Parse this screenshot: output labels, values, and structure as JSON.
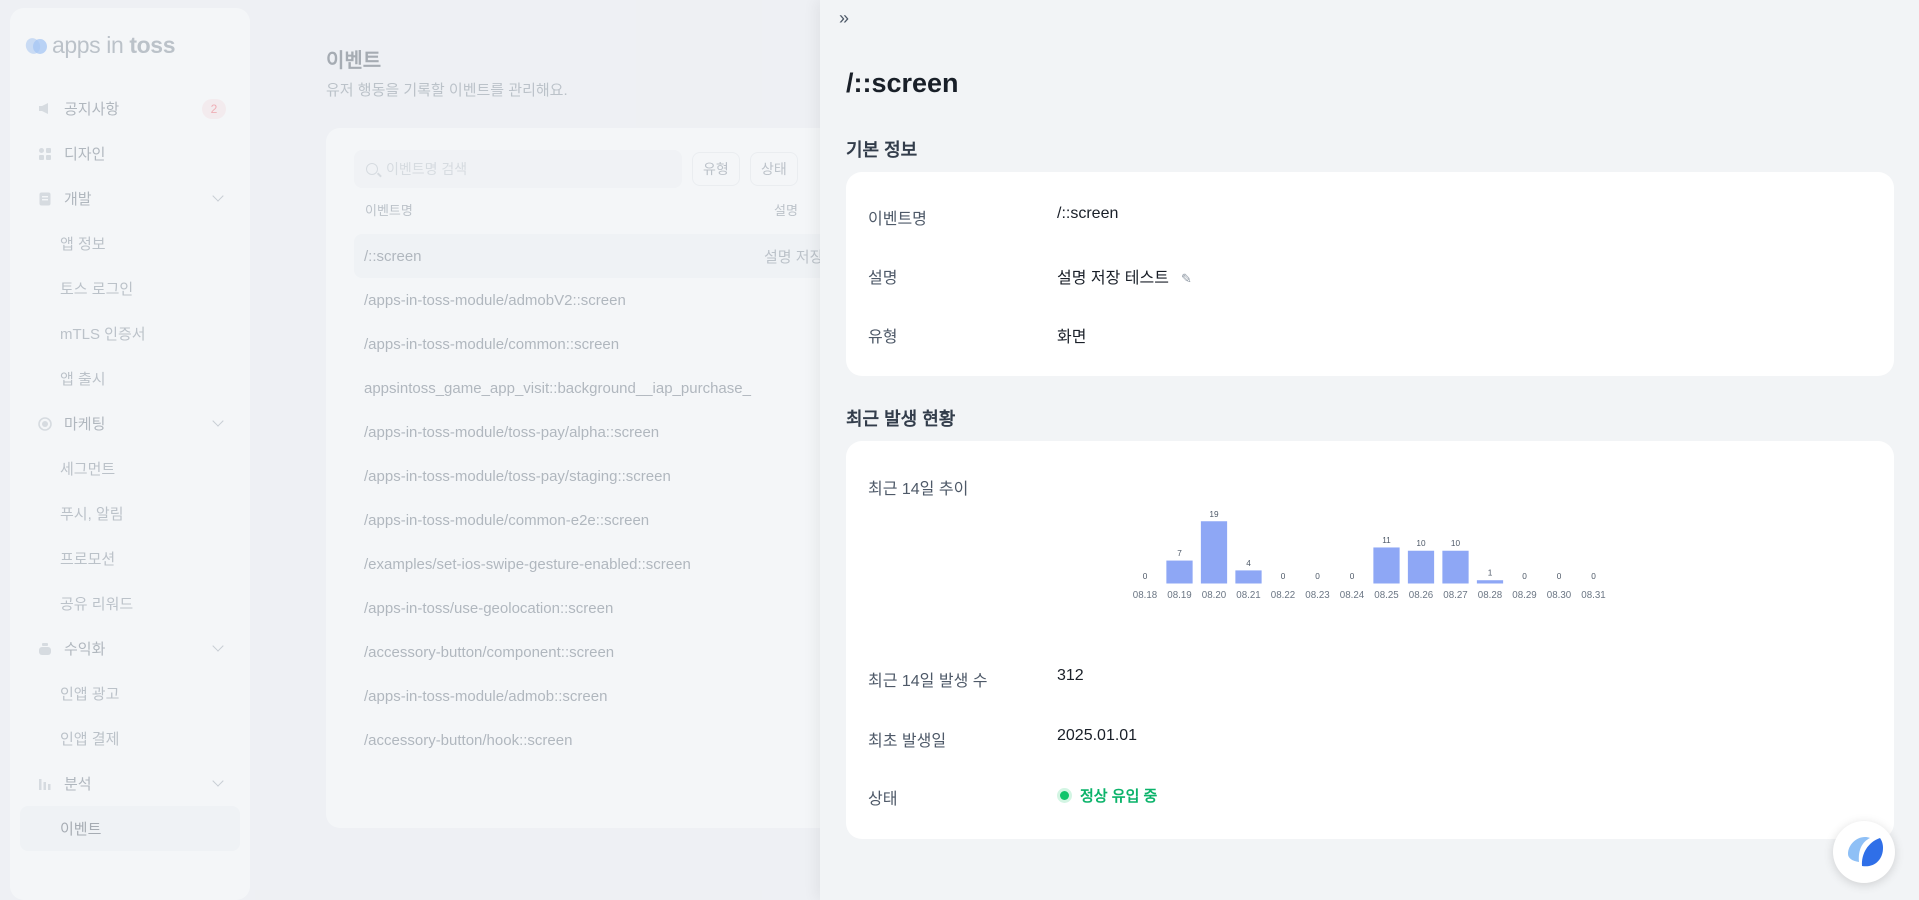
{
  "sidebar": {
    "logo_apps": "apps",
    "logo_in": "in",
    "logo_toss": "toss",
    "notice": {
      "label": "공지사항",
      "badge": "2"
    },
    "design": "디자인",
    "dev": "개발",
    "dev_items": [
      "앱 정보",
      "토스 로그인",
      "mTLS 인증서",
      "앱 출시"
    ],
    "marketing": "마케팅",
    "marketing_items": [
      "세그먼트",
      "푸시, 알림",
      "프로모션",
      "공유 리워드"
    ],
    "monetize": "수익화",
    "monetize_items": [
      "인앱 광고",
      "인앱 결제"
    ],
    "analytics": "분석",
    "analytics_items": [
      "이벤트"
    ]
  },
  "main": {
    "title": "이벤트",
    "subtitle": "유저 행동을 기록할 이벤트를 관리해요.",
    "search_placeholder": "이벤트명 검색",
    "filter_type": "유형",
    "filter_status": "상태",
    "col_name": "이벤트명",
    "col_desc": "설명",
    "rows": [
      {
        "name": "/::screen",
        "desc": "설명 저장"
      },
      {
        "name": "/apps-in-toss-module/admobV2::screen",
        "desc": ""
      },
      {
        "name": "/apps-in-toss-module/common::screen",
        "desc": ""
      },
      {
        "name": "appsintoss_game_app_visit::background__iap_purchase_",
        "desc": ""
      },
      {
        "name": "/apps-in-toss-module/toss-pay/alpha::screen",
        "desc": ""
      },
      {
        "name": "/apps-in-toss-module/toss-pay/staging::screen",
        "desc": ""
      },
      {
        "name": "/apps-in-toss-module/common-e2e::screen",
        "desc": ""
      },
      {
        "name": "/examples/set-ios-swipe-gesture-enabled::screen",
        "desc": ""
      },
      {
        "name": "/apps-in-toss/use-geolocation::screen",
        "desc": ""
      },
      {
        "name": "/accessory-button/component::screen",
        "desc": ""
      },
      {
        "name": "/apps-in-toss-module/admob::screen",
        "desc": ""
      },
      {
        "name": "/accessory-button/hook::screen",
        "desc": ""
      }
    ]
  },
  "drawer": {
    "close_icon": "»",
    "title": "/::screen",
    "basic_section": "기본 정보",
    "name_label": "이벤트명",
    "name_value": "/::screen",
    "desc_label": "설명",
    "desc_value": "설명 저장 테스트",
    "type_label": "유형",
    "type_value": "화면",
    "recent_section": "최근 발생 현황",
    "trend_label": "최근 14일 추이",
    "count_label": "최근 14일 발생 수",
    "count_value": "312",
    "first_label": "최초 발생일",
    "first_value": "2025.01.01",
    "status_label": "상태",
    "status_value": "정상 유입 중"
  },
  "colors": {
    "bar": "#8ea7f5",
    "status_green": "#10c46b",
    "badge_red": "#f04452"
  },
  "chart_data": {
    "type": "bar",
    "categories": [
      "08.18",
      "08.19",
      "08.20",
      "08.21",
      "08.22",
      "08.23",
      "08.24",
      "08.25",
      "08.26",
      "08.27",
      "08.28",
      "08.29",
      "08.30",
      "08.31"
    ],
    "values": [
      0,
      7,
      19,
      4,
      0,
      0,
      0,
      11,
      10,
      10,
      1,
      0,
      0,
      0
    ],
    "title": "최근 14일 추이",
    "grid": false
  }
}
